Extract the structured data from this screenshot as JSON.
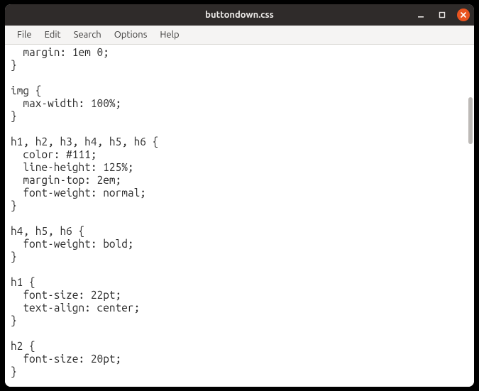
{
  "window": {
    "title": "buttondown.css"
  },
  "menu": {
    "file": "File",
    "edit": "Edit",
    "search": "Search",
    "options": "Options",
    "help": "Help"
  },
  "editor": {
    "content": "  margin: 1em 0;\n}\n\nimg {\n  max-width: 100%;\n}\n\nh1, h2, h3, h4, h5, h6 {\n  color: #111;\n  line-height: 125%;\n  margin-top: 2em;\n  font-weight: normal;\n}\n\nh4, h5, h6 {\n  font-weight: bold;\n}\n\nh1 {\n  font-size: 22pt;\n  text-align: center;\n}\n\nh2 {\n  font-size: 20pt;\n}"
  }
}
